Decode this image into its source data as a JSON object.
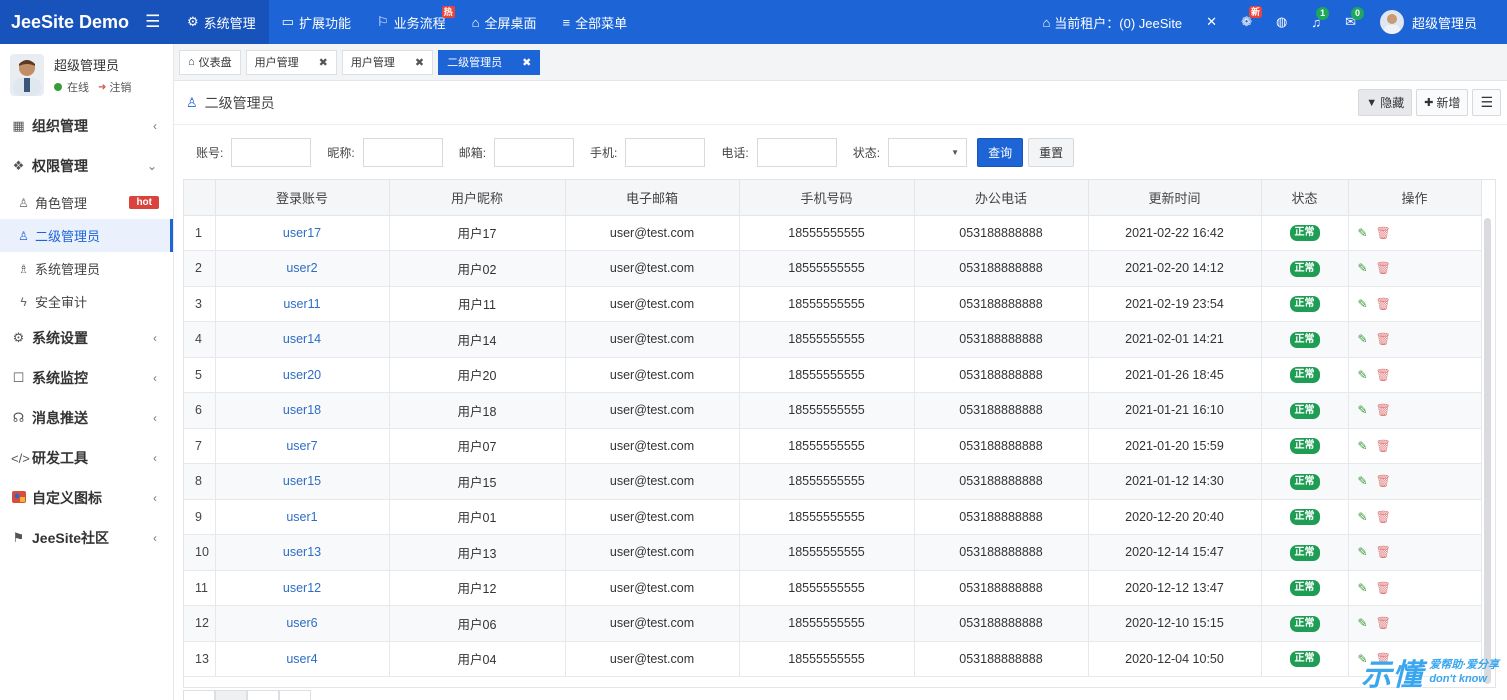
{
  "brand": {
    "title": "JeeSite Demo",
    "menu_toggle_icon": "hamburger-icon"
  },
  "topnav": [
    {
      "label": "系统管理",
      "icon": "gear-icon",
      "active": true
    },
    {
      "label": "扩展功能",
      "icon": "monitor-icon"
    },
    {
      "label": "业务流程",
      "icon": "flag-icon",
      "badge": "热"
    },
    {
      "label": "全屏桌面",
      "icon": "home-icon"
    },
    {
      "label": "全部菜单",
      "icon": "list-icon"
    }
  ],
  "topright": {
    "tenant_label": "当前租户：(0) JeeSite",
    "fullscreen_icon": "expand-icon",
    "apps_badge": "新",
    "language_icon": "globe-icon",
    "notify_count": "1",
    "mail_count": "0",
    "user_name": "超级管理员"
  },
  "sidebar": {
    "user": {
      "name": "超级管理员",
      "status": "在线",
      "logout": "注销"
    },
    "menus": [
      {
        "label": "组织管理",
        "icon": "grid-icon",
        "chevron": "‹"
      },
      {
        "label": "权限管理",
        "icon": "cube-icon",
        "chevron": "⌄",
        "expanded": true
      },
      {
        "label": "系统设置",
        "icon": "gear-icon",
        "chevron": "‹"
      },
      {
        "label": "系统监控",
        "icon": "robot-icon",
        "chevron": "‹"
      },
      {
        "label": "消息推送",
        "icon": "headset-icon",
        "chevron": "‹"
      },
      {
        "label": "研发工具",
        "icon": "code-icon",
        "chevron": "‹"
      },
      {
        "label": "自定义图标",
        "icon": "custom-icon",
        "chevron": "‹"
      },
      {
        "label": "JeeSite社区",
        "icon": "signpost-icon",
        "chevron": "‹"
      }
    ],
    "submenus": [
      {
        "label": "角色管理",
        "icon": "user-icon",
        "badge": "hot"
      },
      {
        "label": "二级管理员",
        "icon": "user-icon",
        "active": true
      },
      {
        "label": "系统管理员",
        "icon": "users-icon"
      },
      {
        "label": "安全审计",
        "icon": "bolt-icon"
      }
    ]
  },
  "tabs": [
    {
      "label": "仪表盘",
      "icon": "home-icon"
    },
    {
      "label": "用户管理",
      "close": "✖"
    },
    {
      "label": "用户管理",
      "close": "✖"
    },
    {
      "label": "二级管理员",
      "close": "✖",
      "active": true
    }
  ],
  "content": {
    "title": "二级管理员",
    "hide_button": "隐藏",
    "add_button": "新增",
    "more_icon": "menu-icon"
  },
  "search": {
    "fields": [
      {
        "label": "账号:",
        "value": ""
      },
      {
        "label": "昵称:",
        "value": ""
      },
      {
        "label": "邮箱:",
        "value": ""
      },
      {
        "label": "手机:",
        "value": ""
      },
      {
        "label": "电话:",
        "value": ""
      }
    ],
    "status_label": "状态:",
    "status_value": "",
    "query_button": "查询",
    "reset_button": "重置"
  },
  "table": {
    "columns": [
      "",
      "登录账号",
      "用户昵称",
      "电子邮箱",
      "手机号码",
      "办公电话",
      "更新时间",
      "状态",
      "操作"
    ],
    "rows": [
      {
        "n": "1",
        "account": "user17",
        "nick": "用户17",
        "email": "user@test.com",
        "mobile": "18555555555",
        "phone": "053188888888",
        "updated": "2021-02-22 16:42",
        "status": "正常"
      },
      {
        "n": "2",
        "account": "user2",
        "nick": "用户02",
        "email": "user@test.com",
        "mobile": "18555555555",
        "phone": "053188888888",
        "updated": "2021-02-20 14:12",
        "status": "正常"
      },
      {
        "n": "3",
        "account": "user11",
        "nick": "用户11",
        "email": "user@test.com",
        "mobile": "18555555555",
        "phone": "053188888888",
        "updated": "2021-02-19 23:54",
        "status": "正常"
      },
      {
        "n": "4",
        "account": "user14",
        "nick": "用户14",
        "email": "user@test.com",
        "mobile": "18555555555",
        "phone": "053188888888",
        "updated": "2021-02-01 14:21",
        "status": "正常"
      },
      {
        "n": "5",
        "account": "user20",
        "nick": "用户20",
        "email": "user@test.com",
        "mobile": "18555555555",
        "phone": "053188888888",
        "updated": "2021-01-26 18:45",
        "status": "正常"
      },
      {
        "n": "6",
        "account": "user18",
        "nick": "用户18",
        "email": "user@test.com",
        "mobile": "18555555555",
        "phone": "053188888888",
        "updated": "2021-01-21 16:10",
        "status": "正常"
      },
      {
        "n": "7",
        "account": "user7",
        "nick": "用户07",
        "email": "user@test.com",
        "mobile": "18555555555",
        "phone": "053188888888",
        "updated": "2021-01-20 15:59",
        "status": "正常"
      },
      {
        "n": "8",
        "account": "user15",
        "nick": "用户15",
        "email": "user@test.com",
        "mobile": "18555555555",
        "phone": "053188888888",
        "updated": "2021-01-12 14:30",
        "status": "正常"
      },
      {
        "n": "9",
        "account": "user1",
        "nick": "用户01",
        "email": "user@test.com",
        "mobile": "18555555555",
        "phone": "053188888888",
        "updated": "2020-12-20 20:40",
        "status": "正常"
      },
      {
        "n": "10",
        "account": "user13",
        "nick": "用户13",
        "email": "user@test.com",
        "mobile": "18555555555",
        "phone": "053188888888",
        "updated": "2020-12-14 15:47",
        "status": "正常"
      },
      {
        "n": "11",
        "account": "user12",
        "nick": "用户12",
        "email": "user@test.com",
        "mobile": "18555555555",
        "phone": "053188888888",
        "updated": "2020-12-12 13:47",
        "status": "正常"
      },
      {
        "n": "12",
        "account": "user6",
        "nick": "用户06",
        "email": "user@test.com",
        "mobile": "18555555555",
        "phone": "053188888888",
        "updated": "2020-12-10 15:15",
        "status": "正常"
      },
      {
        "n": "13",
        "account": "user4",
        "nick": "用户04",
        "email": "user@test.com",
        "mobile": "18555555555",
        "phone": "053188888888",
        "updated": "2020-12-04 10:50",
        "status": "正常"
      }
    ]
  },
  "watermark": {
    "big": "示懂",
    "line1": "爱帮助·爱分享",
    "line2": "don't know"
  }
}
